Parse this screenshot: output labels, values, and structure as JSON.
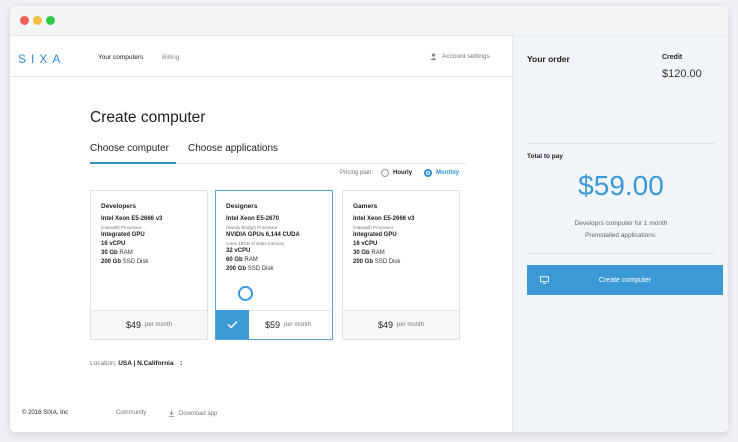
{
  "window": {
    "dots": [
      "#f25f57",
      "#f6be3b",
      "#2fca45"
    ]
  },
  "header": {
    "logo": "SIXA",
    "nav": [
      "Your computers",
      "Billing"
    ],
    "account": "Account settings"
  },
  "main": {
    "title": "Create computer",
    "tabs": [
      "Choose computer",
      "Choose applications"
    ],
    "pricing": {
      "label": "Pricing plan:",
      "options": [
        "Hourly",
        "Monthly"
      ],
      "selected": "Monthly"
    },
    "cards": [
      {
        "name": "Developers",
        "cpu": "Intel Xeon E5-2666 v3",
        "cpu_sub": "(Haswell) Processor",
        "gpu": "Integrated GPU",
        "gpu_sub": "",
        "vcpu": "16 vCPU",
        "ram_val": "30 Gb",
        "ram_unit": "RAM",
        "disk_val": "200 Gb",
        "disk_unit": "SSD Disk",
        "price": "$49",
        "per": "per month",
        "selected": false
      },
      {
        "name": "Designers",
        "cpu": "Intel Xeon E5-2670",
        "cpu_sub": "(Sandy Bridge) Processor",
        "gpu": "NVIDIA GPUs 6,144 CUDA",
        "gpu_sub": "cores 16GB of video memory",
        "vcpu": "32 vCPU",
        "ram_val": "60 Gb",
        "ram_unit": "RAM",
        "disk_val": "200 Gb",
        "disk_unit": "SSD Disk",
        "price": "$59",
        "per": "per month",
        "selected": true
      },
      {
        "name": "Gamers",
        "cpu": "Intel Xeon E5-2666 v3",
        "cpu_sub": "(Haswell) Processor",
        "gpu": "Integrated GPU",
        "gpu_sub": "",
        "vcpu": "16 vCPU",
        "ram_val": "30 Gb",
        "ram_unit": "RAM",
        "disk_val": "200 Gb",
        "disk_unit": "SSD Disk",
        "price": "$49",
        "per": "per month",
        "selected": false
      }
    ],
    "location": {
      "label": "Location:",
      "value": "USA | N.California"
    },
    "footer": {
      "copyright": "© 2016 SIXA, Inc",
      "community": "Community",
      "download": "Download app"
    }
  },
  "sidebar": {
    "order_title": "Your order",
    "credit_label": "Credit",
    "credit_value": "$120.00",
    "total_label": "Total to pay",
    "total_value": "$59.00",
    "desc_line1": "Developrs computer for 1 month",
    "desc_line2": "Preinstalled applications.",
    "create_button": "Create computer"
  },
  "colors": {
    "accent": "#3b9ad6",
    "logo": "#2d8fd0"
  }
}
